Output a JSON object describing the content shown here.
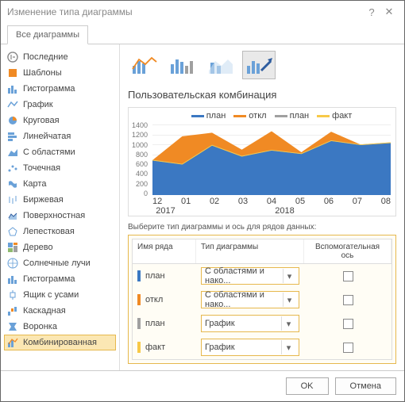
{
  "window": {
    "title": "Изменение типа диаграммы"
  },
  "tabs": {
    "all": "Все диаграммы"
  },
  "sidebar": {
    "items": [
      {
        "label": "Последние"
      },
      {
        "label": "Шаблоны"
      },
      {
        "label": "Гистограмма"
      },
      {
        "label": "График"
      },
      {
        "label": "Круговая"
      },
      {
        "label": "Линейчатая"
      },
      {
        "label": "С областями"
      },
      {
        "label": "Точечная"
      },
      {
        "label": "Карта"
      },
      {
        "label": "Биржевая"
      },
      {
        "label": "Поверхностная"
      },
      {
        "label": "Лепестковая"
      },
      {
        "label": "Дерево"
      },
      {
        "label": "Солнечные лучи"
      },
      {
        "label": "Гистограмма"
      },
      {
        "label": "Ящик с усами"
      },
      {
        "label": "Каскадная"
      },
      {
        "label": "Воронка"
      },
      {
        "label": "Комбинированная"
      }
    ],
    "selected": 18
  },
  "main": {
    "title": "Пользовательская комбинация",
    "series_prompt": "Выберите тип диаграммы и ось для рядов данных:",
    "table": {
      "head_name": "Имя ряда",
      "head_type": "Тип диаграммы",
      "head_aux": "Вспомогательная ось",
      "rows": [
        {
          "name": "план",
          "type": "С областями и нако...",
          "color": "#3b78c2"
        },
        {
          "name": "откл",
          "type": "С областями и нако...",
          "color": "#f08a24"
        },
        {
          "name": "план",
          "type": "График",
          "color": "#a0a0a0"
        },
        {
          "name": "факт",
          "type": "График",
          "color": "#f7c948"
        }
      ]
    }
  },
  "chart_data": {
    "type": "area",
    "title": "",
    "legend": [
      "план",
      "откл",
      "план",
      "факт"
    ],
    "legend_colors": [
      "#3b78c2",
      "#f08a24",
      "#a0a0a0",
      "#f7c948"
    ],
    "x": [
      "12",
      "01",
      "02",
      "03",
      "04",
      "05",
      "06",
      "07",
      "08"
    ],
    "x_groups": [
      "2017",
      "2018"
    ],
    "ylim": [
      0,
      1400
    ],
    "yticks": [
      0,
      200,
      400,
      600,
      800,
      1000,
      1200,
      1400
    ],
    "series": [
      {
        "name": "план",
        "type": "area",
        "color": "#3b78c2",
        "values": [
          700,
          620,
          1000,
          780,
          900,
          830,
          1090,
          1010,
          1050
        ]
      },
      {
        "name": "откл",
        "type": "area_stacked_on_plan",
        "color": "#f08a24",
        "values": [
          0,
          560,
          250,
          130,
          380,
          30,
          180,
          0,
          0
        ]
      },
      {
        "name": "план",
        "type": "line",
        "color": "#a0a0a0",
        "values": [
          700,
          620,
          1000,
          780,
          900,
          830,
          1090,
          1010,
          1050
        ]
      },
      {
        "name": "факт",
        "type": "line",
        "color": "#f7c948",
        "values": [
          700,
          620,
          1000,
          780,
          900,
          830,
          1090,
          1010,
          1050
        ]
      }
    ]
  },
  "footer": {
    "ok": "OK",
    "cancel": "Отмена"
  }
}
